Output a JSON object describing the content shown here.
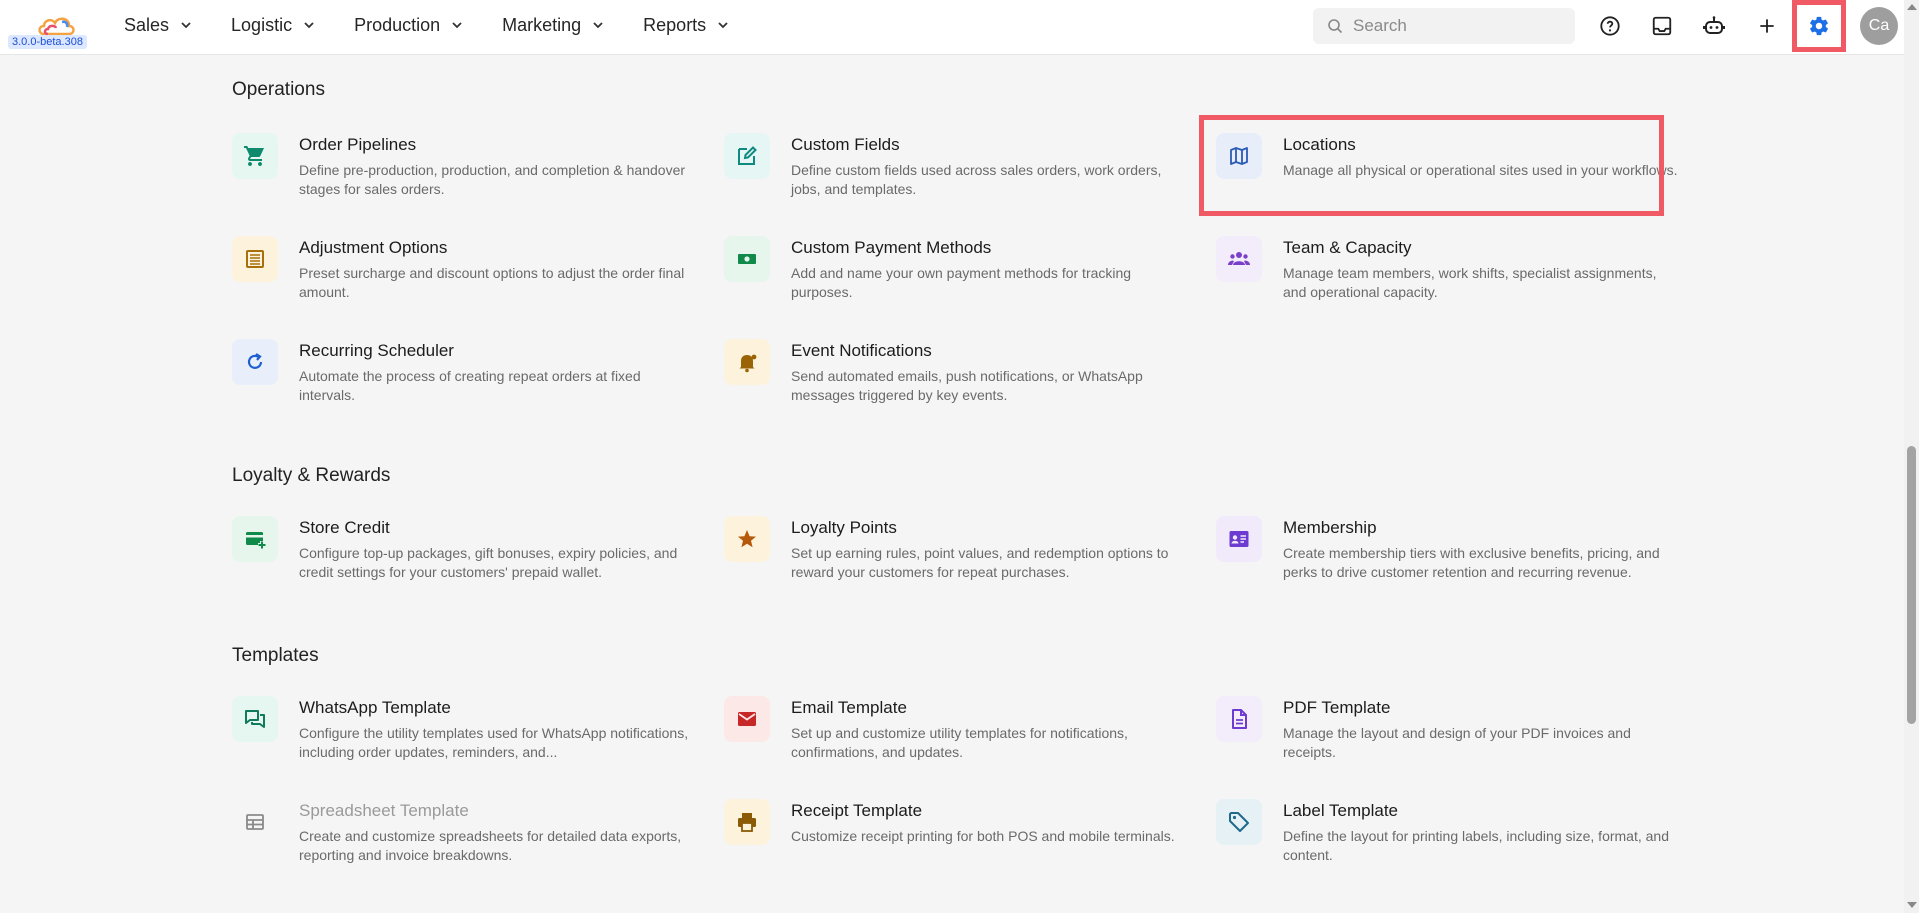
{
  "app": {
    "version": "3.0.0-beta.308"
  },
  "nav": {
    "items": [
      {
        "label": "Sales"
      },
      {
        "label": "Logistic"
      },
      {
        "label": "Production"
      },
      {
        "label": "Marketing"
      },
      {
        "label": "Reports"
      }
    ]
  },
  "search": {
    "placeholder": "Search"
  },
  "avatar": {
    "initials": "Ca"
  },
  "colors": {
    "accent": "#1d6fe8",
    "highlight": "#ef5a64"
  },
  "sections": [
    {
      "title": "Operations",
      "cards": [
        {
          "title": "Order Pipelines",
          "desc": "Define pre-production, production, and completion & handover stages for sales orders.",
          "icon": "cart-icon"
        },
        {
          "title": "Custom Fields",
          "desc": "Define custom fields used across sales orders, work orders, jobs, and templates.",
          "icon": "edit-icon"
        },
        {
          "title": "Locations",
          "desc": "Manage all physical or operational sites used in your workflows.",
          "icon": "map-icon"
        },
        {
          "title": "Adjustment Options",
          "desc": "Preset surcharge and discount options to adjust the order final amount.",
          "icon": "list-icon"
        },
        {
          "title": "Custom Payment Methods",
          "desc": "Add and name your own payment methods for tracking purposes.",
          "icon": "cash-icon"
        },
        {
          "title": "Team & Capacity",
          "desc": "Manage team members, work shifts, specialist assignments, and operational capacity.",
          "icon": "team-icon"
        },
        {
          "title": "Recurring Scheduler",
          "desc": "Automate the process of creating repeat orders at fixed intervals.",
          "icon": "refresh-icon"
        },
        {
          "title": "Event Notifications",
          "desc": "Send automated emails, push notifications, or WhatsApp messages triggered by key events.",
          "icon": "bell-icon"
        }
      ]
    },
    {
      "title": "Loyalty & Rewards",
      "cards": [
        {
          "title": "Store Credit",
          "desc": "Configure top-up packages, gift bonuses, expiry policies, and credit settings for your customers' prepaid wallet.",
          "icon": "card-add-icon"
        },
        {
          "title": "Loyalty Points",
          "desc": "Set up earning rules, point values, and redemption options to reward your customers for repeat purchases.",
          "icon": "star-icon"
        },
        {
          "title": "Membership",
          "desc": "Create membership tiers with exclusive benefits, pricing, and perks to drive customer retention and recurring revenue.",
          "icon": "id-card-icon"
        }
      ]
    },
    {
      "title": "Templates",
      "cards": [
        {
          "title": "WhatsApp Template",
          "desc": "Configure the utility templates used for WhatsApp notifications, including order updates, reminders, and...",
          "icon": "chat-icon"
        },
        {
          "title": "Email Template",
          "desc": "Set up and customize utility templates for notifications, confirmations, and updates.",
          "icon": "mail-icon"
        },
        {
          "title": "PDF Template",
          "desc": "Manage the layout and design of your PDF invoices and receipts.",
          "icon": "document-icon"
        },
        {
          "title": "Spreadsheet Template",
          "desc": "Create and customize spreadsheets for detailed data exports, reporting and invoice breakdowns.",
          "icon": "table-icon"
        },
        {
          "title": "Receipt Template",
          "desc": "Customize receipt printing for both POS and mobile terminals.",
          "icon": "printer-icon"
        },
        {
          "title": "Label Template",
          "desc": "Define the layout for printing labels, including size, format, and content.",
          "icon": "tag-icon"
        }
      ]
    }
  ]
}
